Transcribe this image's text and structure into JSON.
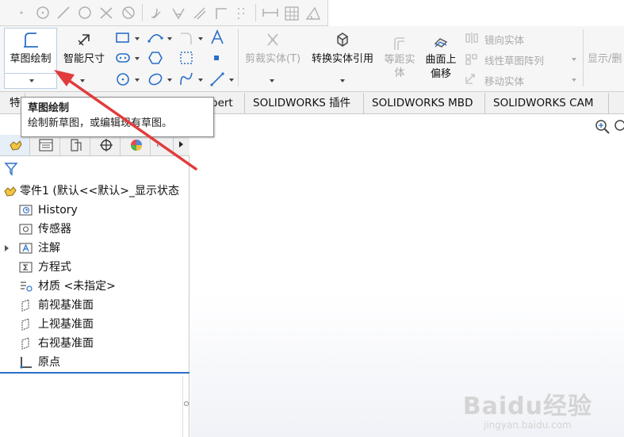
{
  "toolbar": {
    "sketch_label": "草图绘制",
    "smart_dim_label": "智能尺寸",
    "trim_label": "剪裁实体(T)",
    "convert_label": "转换实体引用",
    "offset_label_line1": "等距实",
    "offset_label_line2": "体",
    "surface_offset_line1": "曲面上",
    "surface_offset_line2": "偏移",
    "mirror_label": "镜向实体",
    "linear_pattern_label": "线性草图阵列",
    "move_label": "移动实体",
    "show_delete_label": "显示/删"
  },
  "tabs": [
    {
      "label": "特"
    },
    {
      "label": "pert"
    },
    {
      "label": "SOLIDWORKS 插件"
    },
    {
      "label": "SOLIDWORKS MBD"
    },
    {
      "label": "SOLIDWORKS CAM"
    }
  ],
  "tooltip": {
    "title": "草图绘制",
    "description": "绘制新草图，或编辑现有草图。"
  },
  "tree": {
    "root": "零件1 (默认<<默认>_显示状态",
    "items": [
      {
        "label": "History"
      },
      {
        "label": "传感器"
      },
      {
        "label": "注解"
      },
      {
        "label": "方程式"
      },
      {
        "label": "材质 <未指定>"
      },
      {
        "label": "前视基准面"
      },
      {
        "label": "上视基准面"
      },
      {
        "label": "右视基准面"
      },
      {
        "label": "原点"
      }
    ]
  },
  "watermark": {
    "brand": "Baidu经验",
    "url": "jingyan.baidu.com"
  },
  "colors": {
    "accent_blue": "#2a6fc9",
    "arrow_red": "#e23b3b"
  }
}
